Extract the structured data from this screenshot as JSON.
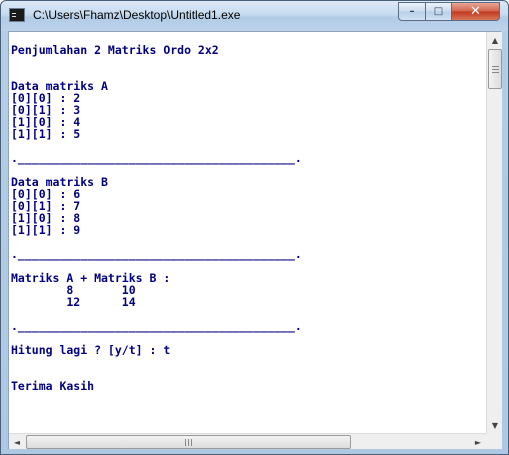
{
  "window": {
    "title": "C:\\Users\\Fhamz\\Desktop\\Untitled1.exe",
    "controls": {
      "minimize": "–",
      "maximize": "□",
      "close": "✕"
    }
  },
  "console": {
    "lines": [
      "",
      "Penjumlahan 2 Matriks Ordo 2x2",
      "",
      "",
      "Data matriks A",
      "[0][0] : 2",
      "[0][1] : 3",
      "[1][0] : 4",
      "[1][1] : 5",
      "",
      ".________________________________________.",
      "",
      "Data matriks B",
      "[0][0] : 6",
      "[0][1] : 7",
      "[1][0] : 8",
      "[1][1] : 9",
      "",
      ".________________________________________.",
      "",
      "Matriks A + Matriks B :",
      "        8       10",
      "        12      14",
      "",
      ".________________________________________.",
      "",
      "Hitung lagi ? [y/t] : t",
      "",
      "",
      "Terima Kasih"
    ]
  },
  "scrollbars": {
    "vertical": {
      "up": "▲",
      "down": "▼"
    },
    "horizontal": {
      "left": "◄",
      "right": "►"
    }
  }
}
